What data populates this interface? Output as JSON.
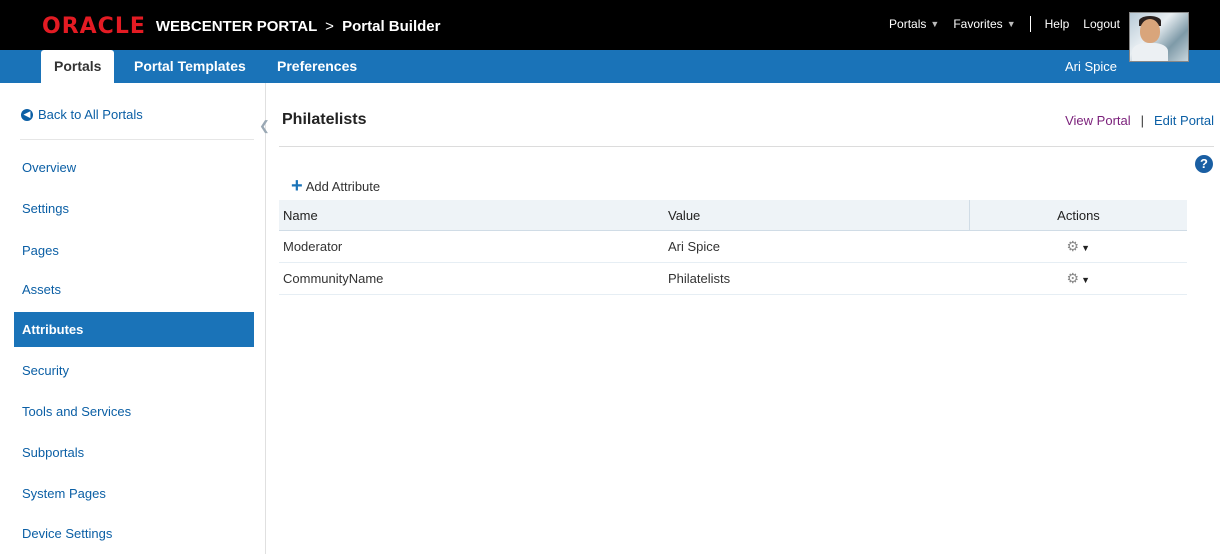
{
  "header": {
    "brand": "ORACLE",
    "product": "WEBCENTER PORTAL",
    "separator": ">",
    "app_name": "Portal Builder",
    "nav": {
      "portals": "Portals",
      "favorites": "Favorites",
      "help": "Help",
      "logout": "Logout"
    }
  },
  "tabs": {
    "portals": "Portals",
    "portal_templates": "Portal Templates",
    "preferences": "Preferences"
  },
  "user": {
    "name": "Ari Spice"
  },
  "sidebar": {
    "back_label": "Back to All Portals",
    "items": [
      {
        "label": "Overview"
      },
      {
        "label": "Settings"
      },
      {
        "label": "Pages"
      },
      {
        "label": "Assets"
      },
      {
        "label": "Attributes",
        "active": true
      },
      {
        "label": "Security"
      },
      {
        "label": "Tools and Services"
      },
      {
        "label": "Subportals"
      },
      {
        "label": "System Pages"
      },
      {
        "label": "Device Settings"
      }
    ]
  },
  "main": {
    "title": "Philatelists",
    "view_portal": "View Portal",
    "link_separator": "|",
    "edit_portal": "Edit Portal",
    "help_glyph": "?",
    "add_attribute": "Add Attribute",
    "table": {
      "headers": {
        "name": "Name",
        "value": "Value",
        "actions": "Actions"
      },
      "rows": [
        {
          "name": "Moderator",
          "value": "Ari Spice"
        },
        {
          "name": "CommunityName",
          "value": "Philatelists"
        }
      ]
    }
  },
  "colors": {
    "tabbar_blue": "#1a73b8",
    "link_blue": "#0b5fa5",
    "oracle_red": "#e31b23",
    "visited_purple": "#7a1f7a"
  }
}
